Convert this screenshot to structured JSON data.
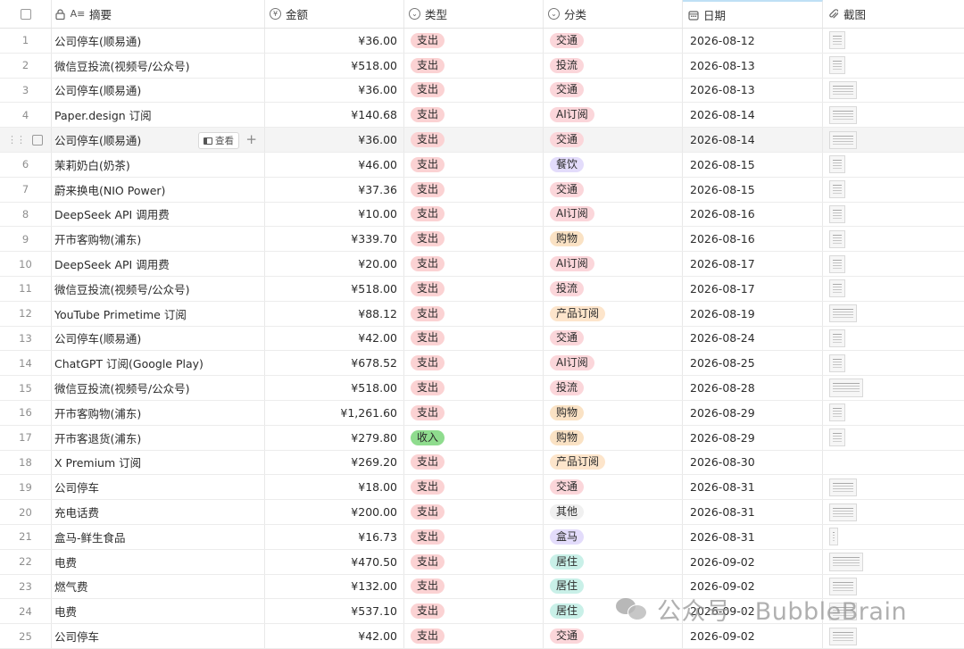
{
  "headers": {
    "summary": "摘要",
    "amount": "金额",
    "type": "类型",
    "category": "分类",
    "date": "日期",
    "screenshot": "截图"
  },
  "header_icons": {
    "summary": "lock-text-icon",
    "amount": "currency-icon",
    "type": "select-icon",
    "category": "select-icon",
    "date": "calendar-icon",
    "screenshot": "paperclip-icon"
  },
  "hover_row": {
    "index": 5,
    "view_label": "查看"
  },
  "tag_colors": {
    "支出": "#fbd2d3",
    "收入": "#8fdc8e",
    "交通": "#fbd6da",
    "投流": "#fbd6da",
    "AI订阅": "#fbd6da",
    "餐饮": "#e3dcfb",
    "购物": "#fae2c4",
    "产品订阅": "#fde5cb",
    "其他": "#f0f0f0",
    "盒马": "#e3dcfb",
    "居住": "#c9f0e8"
  },
  "rows": [
    {
      "n": "1",
      "summary": "公司停车(顺易通)",
      "amount": "¥36.00",
      "type": "支出",
      "category": "交通",
      "date": "2026-08-12",
      "thumb": "n"
    },
    {
      "n": "2",
      "summary": "微信豆投流(视频号/公众号)",
      "amount": "¥518.00",
      "type": "支出",
      "category": "投流",
      "date": "2026-08-13",
      "thumb": "n"
    },
    {
      "n": "3",
      "summary": "公司停车(顺易通)",
      "amount": "¥36.00",
      "type": "支出",
      "category": "交通",
      "date": "2026-08-13",
      "thumb": "w"
    },
    {
      "n": "4",
      "summary": "Paper.design 订阅",
      "amount": "¥140.68",
      "type": "支出",
      "category": "AI订阅",
      "date": "2026-08-14",
      "thumb": "w"
    },
    {
      "n": "5",
      "summary": "公司停车(顺易通)",
      "amount": "¥36.00",
      "type": "支出",
      "category": "交通",
      "date": "2026-08-14",
      "thumb": "w"
    },
    {
      "n": "6",
      "summary": "茉莉奶白(奶茶)",
      "amount": "¥46.00",
      "type": "支出",
      "category": "餐饮",
      "date": "2026-08-15",
      "thumb": "n"
    },
    {
      "n": "7",
      "summary": "蔚来换电(NIO Power)",
      "amount": "¥37.36",
      "type": "支出",
      "category": "交通",
      "date": "2026-08-15",
      "thumb": "n"
    },
    {
      "n": "8",
      "summary": "DeepSeek API 调用费",
      "amount": "¥10.00",
      "type": "支出",
      "category": "AI订阅",
      "date": "2026-08-16",
      "thumb": "n"
    },
    {
      "n": "9",
      "summary": "开市客购物(浦东)",
      "amount": "¥339.70",
      "type": "支出",
      "category": "购物",
      "date": "2026-08-16",
      "thumb": "n"
    },
    {
      "n": "10",
      "summary": "DeepSeek API 调用费",
      "amount": "¥20.00",
      "type": "支出",
      "category": "AI订阅",
      "date": "2026-08-17",
      "thumb": "n"
    },
    {
      "n": "11",
      "summary": "微信豆投流(视频号/公众号)",
      "amount": "¥518.00",
      "type": "支出",
      "category": "投流",
      "date": "2026-08-17",
      "thumb": "n"
    },
    {
      "n": "12",
      "summary": "YouTube Primetime 订阅",
      "amount": "¥88.12",
      "type": "支出",
      "category": "产品订阅",
      "date": "2026-08-19",
      "thumb": "w"
    },
    {
      "n": "13",
      "summary": "公司停车(顺易通)",
      "amount": "¥42.00",
      "type": "支出",
      "category": "交通",
      "date": "2026-08-24",
      "thumb": "n"
    },
    {
      "n": "14",
      "summary": "ChatGPT 订阅(Google Play)",
      "amount": "¥678.52",
      "type": "支出",
      "category": "AI订阅",
      "date": "2026-08-25",
      "thumb": "n"
    },
    {
      "n": "15",
      "summary": "微信豆投流(视频号/公众号)",
      "amount": "¥518.00",
      "type": "支出",
      "category": "投流",
      "date": "2026-08-28",
      "thumb": "xw"
    },
    {
      "n": "16",
      "summary": "开市客购物(浦东)",
      "amount": "¥1,261.60",
      "type": "支出",
      "category": "购物",
      "date": "2026-08-29",
      "thumb": "n"
    },
    {
      "n": "17",
      "summary": "开市客退货(浦东)",
      "amount": "¥279.80",
      "type": "收入",
      "category": "购物",
      "date": "2026-08-29",
      "thumb": "n"
    },
    {
      "n": "18",
      "summary": "X Premium 订阅",
      "amount": "¥269.20",
      "type": "支出",
      "category": "产品订阅",
      "date": "2026-08-30",
      "thumb": ""
    },
    {
      "n": "19",
      "summary": "公司停车",
      "amount": "¥18.00",
      "type": "支出",
      "category": "交通",
      "date": "2026-08-31",
      "thumb": "w"
    },
    {
      "n": "20",
      "summary": "充电话费",
      "amount": "¥200.00",
      "type": "支出",
      "category": "其他",
      "date": "2026-08-31",
      "thumb": "w"
    },
    {
      "n": "21",
      "summary": "盒马-鲜生食品",
      "amount": "¥16.73",
      "type": "支出",
      "category": "盒马",
      "date": "2026-08-31",
      "thumb": "s"
    },
    {
      "n": "22",
      "summary": "电费",
      "amount": "¥470.50",
      "type": "支出",
      "category": "居住",
      "date": "2026-09-02",
      "thumb": "xw"
    },
    {
      "n": "23",
      "summary": "燃气费",
      "amount": "¥132.00",
      "type": "支出",
      "category": "居住",
      "date": "2026-09-02",
      "thumb": "w"
    },
    {
      "n": "24",
      "summary": "电费",
      "amount": "¥537.10",
      "type": "支出",
      "category": "居住",
      "date": "2026-09-02",
      "thumb": "w"
    },
    {
      "n": "25",
      "summary": "公司停车",
      "amount": "¥42.00",
      "type": "支出",
      "category": "交通",
      "date": "2026-09-02",
      "thumb": "w"
    }
  ],
  "watermark": {
    "text": "公众号 · BubbleBrain"
  }
}
